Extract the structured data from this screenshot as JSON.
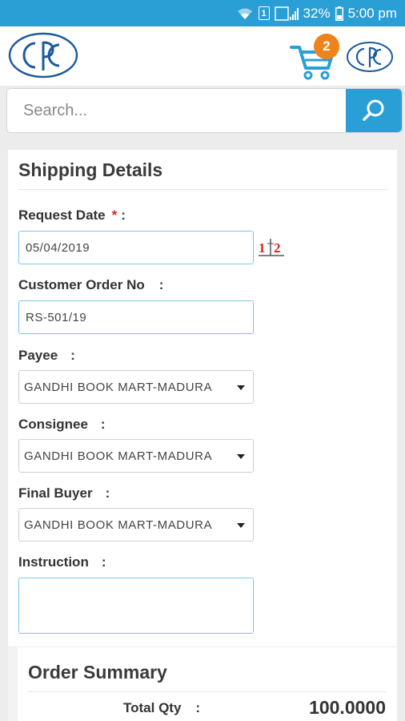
{
  "status_bar": {
    "battery": "32%",
    "time": "5:00 pm",
    "sim_label": "1"
  },
  "header": {
    "cart_count": "2"
  },
  "search": {
    "placeholder": "Search..."
  },
  "shipping": {
    "title": "Shipping Details",
    "request_date": {
      "label": "Request Date",
      "required_mark": "*",
      "colon": ":",
      "value": "05/04/2019"
    },
    "customer_order_no": {
      "label": "Customer Order No",
      "colon": ":",
      "value": "RS-501/19"
    },
    "payee": {
      "label": "Payee",
      "colon": ":",
      "value": "GANDHI BOOK MART-MADURA"
    },
    "consignee": {
      "label": "Consignee",
      "colon": ":",
      "value": "GANDHI BOOK MART-MADURA"
    },
    "final_buyer": {
      "label": "Final Buyer",
      "colon": ":",
      "value": "GANDHI BOOK MART-MADURA"
    },
    "instruction": {
      "label": "Instruction",
      "colon": ":",
      "value": ""
    }
  },
  "summary": {
    "title": "Order Summary",
    "total_qty_label": "Total Qty",
    "colon": ":",
    "total_qty_value": "100.0000"
  },
  "colors": {
    "accent": "#2a9fd6",
    "badge": "#f0821e",
    "input_border": "#7ac8e6",
    "required": "#e02020"
  },
  "icons": [
    "wifi-icon",
    "sim-icon",
    "signal-icon",
    "battery-icon",
    "cpc-logo",
    "cart-icon",
    "search-icon",
    "calendar-icon",
    "dropdown-caret-icon"
  ]
}
